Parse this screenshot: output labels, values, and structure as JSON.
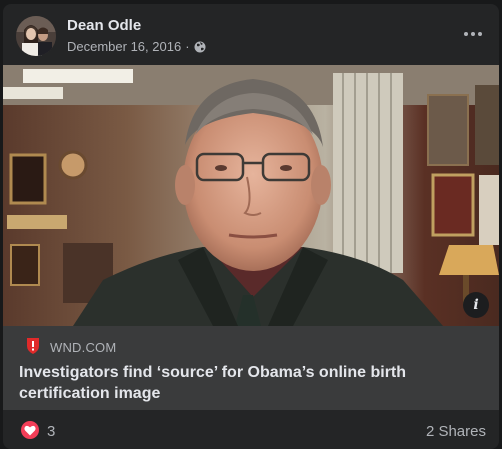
{
  "post": {
    "author": "Dean Odle",
    "date": "December 16, 2016",
    "separator": "·",
    "privacy_icon": "globe-icon",
    "more_icon": "more-options-icon"
  },
  "link_preview": {
    "image_description": "photo of an older man in glasses, suit and tie in an office",
    "info_icon": "info-icon",
    "info_label": "i",
    "source_icon": "shield-icon",
    "domain": "WND.COM",
    "headline": "Investigators find ‘source’ for Obama’s online birth certification image"
  },
  "footer": {
    "reaction_icon": "love-reaction-icon",
    "reaction_count": "3",
    "shares": "2 Shares"
  },
  "colors": {
    "card": "#242526",
    "link_bg": "#3a3b3c",
    "text": "#e4e6eb",
    "secondary": "#b0b3b8",
    "love": "#f33e58",
    "source_red": "#e02a2a"
  }
}
